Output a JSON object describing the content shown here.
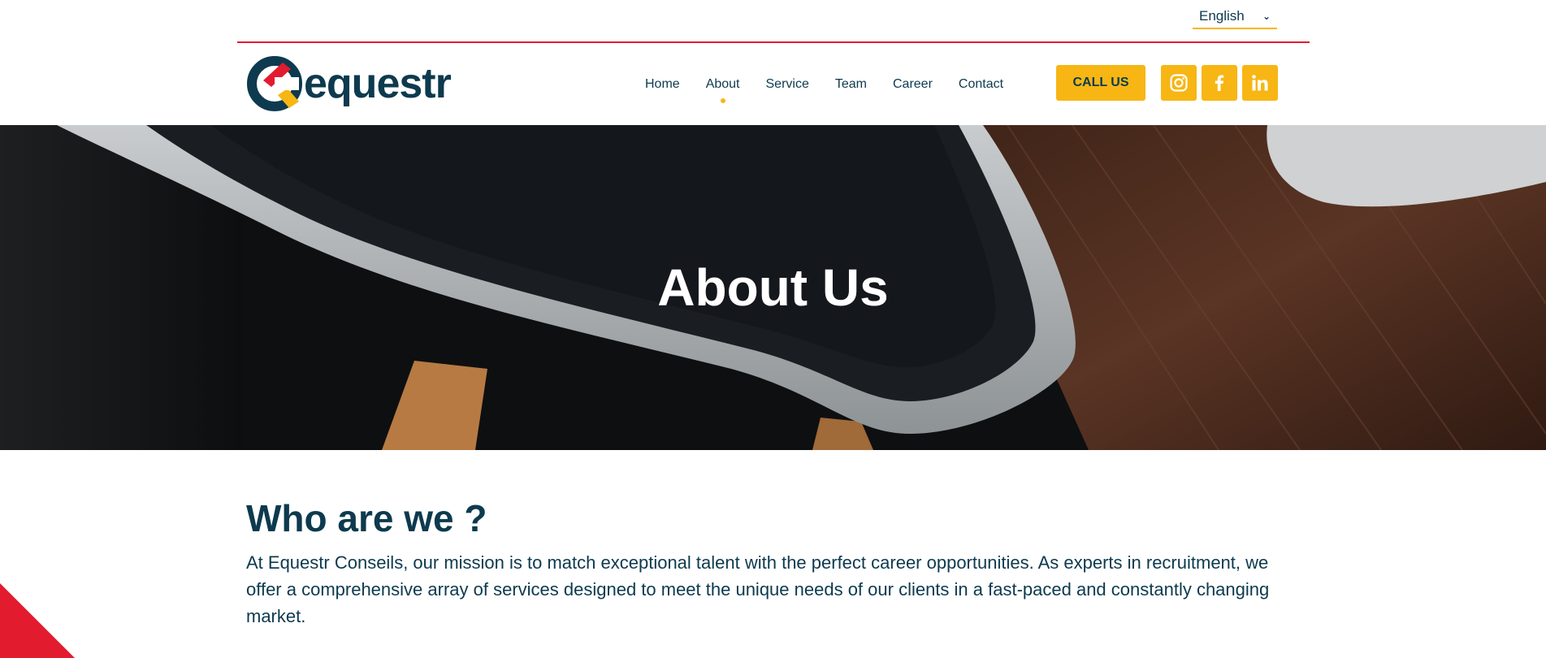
{
  "language": {
    "selected": "English"
  },
  "logo": {
    "text": "equestr"
  },
  "nav": {
    "items": [
      {
        "label": "Home"
      },
      {
        "label": "About"
      },
      {
        "label": "Service"
      },
      {
        "label": "Team"
      },
      {
        "label": "Career"
      },
      {
        "label": "Contact"
      }
    ],
    "active": "About"
  },
  "cta": {
    "label": "CALL US"
  },
  "social": {
    "icons": [
      "instagram-icon",
      "facebook-icon",
      "linkedin-icon"
    ]
  },
  "hero": {
    "title": "About Us"
  },
  "about": {
    "heading": "Who are we ?",
    "body": "At Equestr Conseils, our mission is to match exceptional talent with the perfect career opportunities. As experts in recruitment, we offer a comprehensive array of services designed to meet the unique needs of our clients in a fast-paced and constantly changing market."
  },
  "colors": {
    "brand_navy": "#0d3a4e",
    "accent_yellow": "#f7b614",
    "accent_red": "#e31b2f"
  }
}
